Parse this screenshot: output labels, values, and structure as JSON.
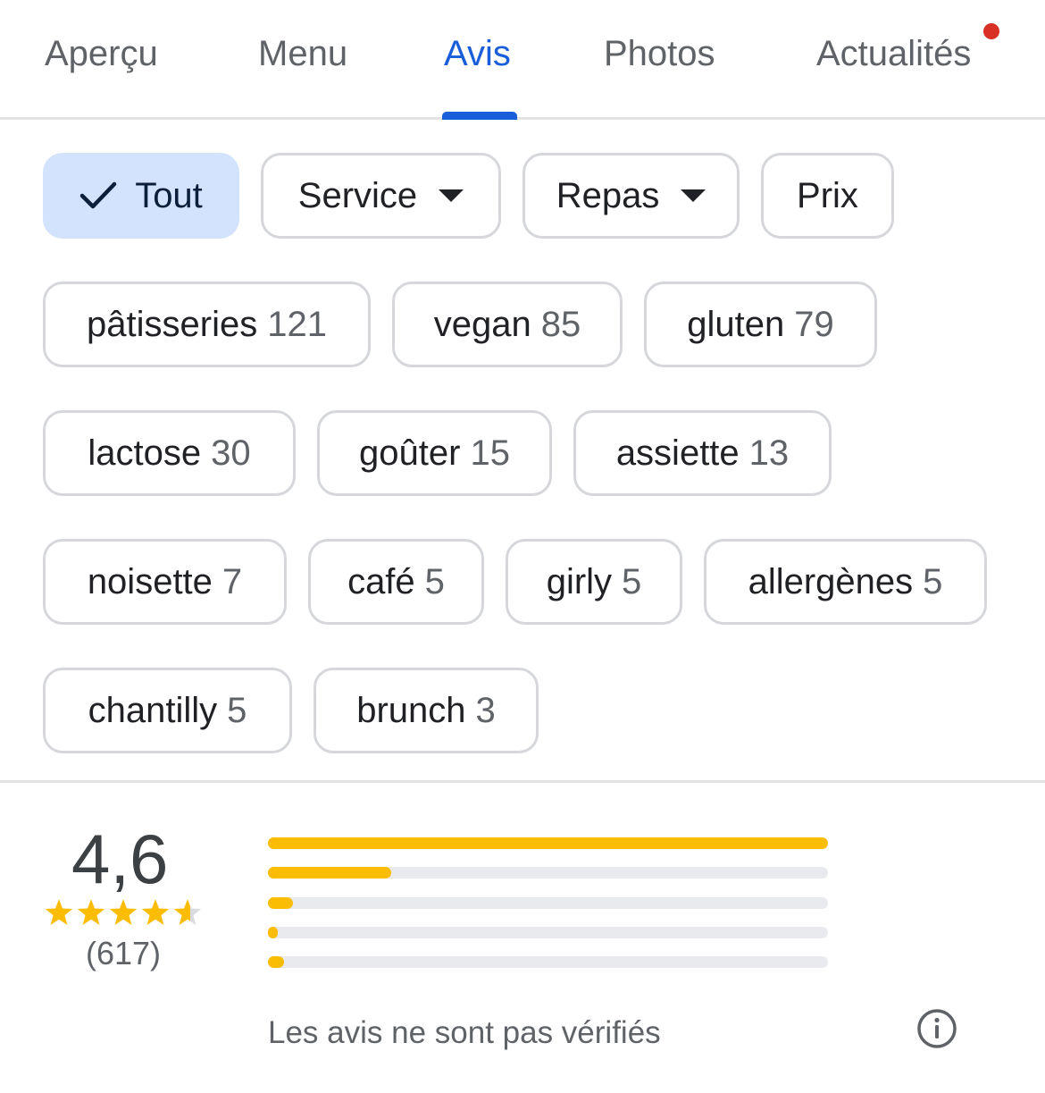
{
  "tabs": [
    {
      "label": "Aperçu"
    },
    {
      "label": "Menu"
    },
    {
      "label": "Avis"
    },
    {
      "label": "Photos"
    },
    {
      "label": "Actualités"
    }
  ],
  "active_tab": "Avis",
  "filters": {
    "tout": "Tout",
    "service": "Service",
    "repas": "Repas",
    "prix": "Prix"
  },
  "topics": [
    {
      "label": "pâtisseries",
      "count": "121"
    },
    {
      "label": "vegan",
      "count": "85"
    },
    {
      "label": "gluten",
      "count": "79"
    },
    {
      "label": "lactose",
      "count": "30"
    },
    {
      "label": "goûter",
      "count": "15"
    },
    {
      "label": "assiette",
      "count": "13"
    },
    {
      "label": "noisette",
      "count": "7"
    },
    {
      "label": "café",
      "count": "5"
    },
    {
      "label": "girly",
      "count": "5"
    },
    {
      "label": "allergènes",
      "count": "5"
    },
    {
      "label": "chantilly",
      "count": "5"
    },
    {
      "label": "brunch",
      "count": "3"
    }
  ],
  "rating": {
    "average": "4,6",
    "stars": 4.6,
    "review_count": "(617)",
    "distribution": [
      1.0,
      0.22,
      0.045,
      0.018,
      0.028
    ]
  },
  "disclaimer": "Les avis ne sont pas vérifiés",
  "colors": {
    "accent": "#1a5ed9",
    "star": "#fbbc04",
    "notification": "#d93025",
    "selected_chip": "#d3e3fd"
  }
}
